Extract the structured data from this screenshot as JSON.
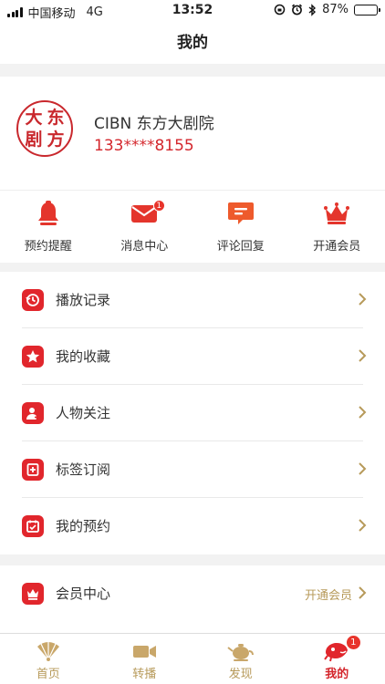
{
  "status_bar": {
    "carrier": "中国移动",
    "network": "4G",
    "time": "13:52",
    "battery_percent": "87%",
    "battery_level": 0.87
  },
  "nav": {
    "title": "我的"
  },
  "profile": {
    "avatar_chars": [
      "大",
      "东",
      "剧",
      "方"
    ],
    "name": "CIBN 东方大剧院",
    "phone": "133****8155"
  },
  "quick_actions": [
    {
      "label": "预约提醒",
      "icon": "bell-icon"
    },
    {
      "label": "消息中心",
      "icon": "mail-icon",
      "badge": "1"
    },
    {
      "label": "评论回复",
      "icon": "comment-icon"
    },
    {
      "label": "开通会员",
      "icon": "crown-icon"
    }
  ],
  "menu_list": [
    {
      "label": "播放记录",
      "icon": "history-icon"
    },
    {
      "label": "我的收藏",
      "icon": "star-icon"
    },
    {
      "label": "人物关注",
      "icon": "person-add-icon"
    },
    {
      "label": "标签订阅",
      "icon": "tag-subscribe-icon"
    },
    {
      "label": "我的预约",
      "icon": "calendar-icon"
    }
  ],
  "member_list": [
    {
      "label": "会员中心",
      "icon": "crown-icon",
      "extra": "开通会员"
    }
  ],
  "tab_bar": [
    {
      "label": "首页",
      "icon": "fan-icon"
    },
    {
      "label": "转播",
      "icon": "video-camera-icon"
    },
    {
      "label": "发现",
      "icon": "teapot-icon"
    },
    {
      "label": "我的",
      "icon": "lion-icon",
      "badge": "1",
      "active": true
    }
  ],
  "colors": {
    "accent": "#d4262c",
    "gold": "#b79a5a",
    "background": "#f2f2f2"
  }
}
